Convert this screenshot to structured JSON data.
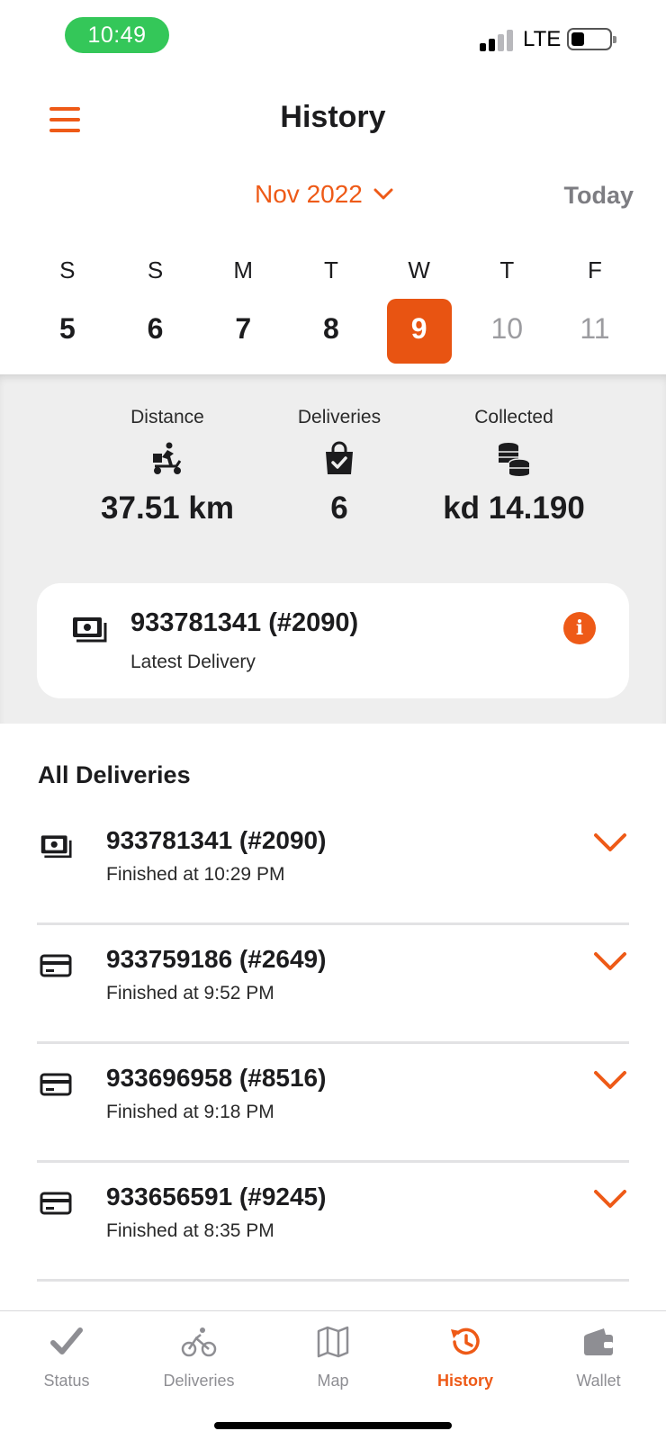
{
  "status_bar": {
    "time": "10:49",
    "network": "LTE"
  },
  "header": {
    "title": "History"
  },
  "month_picker": {
    "label": "Nov 2022",
    "today_label": "Today"
  },
  "week": [
    {
      "dow": "S",
      "day": "5",
      "state": "past"
    },
    {
      "dow": "S",
      "day": "6",
      "state": "past"
    },
    {
      "dow": "M",
      "day": "7",
      "state": "past"
    },
    {
      "dow": "T",
      "day": "8",
      "state": "past"
    },
    {
      "dow": "W",
      "day": "9",
      "state": "selected"
    },
    {
      "dow": "T",
      "day": "10",
      "state": "future"
    },
    {
      "dow": "F",
      "day": "11",
      "state": "future"
    }
  ],
  "stats": {
    "distance": {
      "label": "Distance",
      "value": "37.51 km",
      "icon": "scooter-delivery-icon"
    },
    "deliveries": {
      "label": "Deliveries",
      "value": "6",
      "icon": "shopping-bag-check-icon"
    },
    "collected": {
      "label": "Collected",
      "value": "kd 14.190",
      "icon": "coins-stack-icon"
    }
  },
  "latest": {
    "order": "933781341 (#2090)",
    "subtitle": "Latest Delivery",
    "icon": "cash-icon"
  },
  "all_deliveries": {
    "title": "All Deliveries",
    "items": [
      {
        "order": "933781341 (#2090)",
        "finished": "Finished at 10:29 PM",
        "payment": "cash"
      },
      {
        "order": "933759186 (#2649)",
        "finished": "Finished at 9:52 PM",
        "payment": "card"
      },
      {
        "order": "933696958 (#8516)",
        "finished": "Finished at 9:18 PM",
        "payment": "card"
      },
      {
        "order": "933656591 (#9245)",
        "finished": "Finished at 8:35 PM",
        "payment": "card"
      }
    ]
  },
  "tab_bar": {
    "items": [
      {
        "label": "Status",
        "icon": "checkmark-icon"
      },
      {
        "label": "Deliveries",
        "icon": "bicycle-icon"
      },
      {
        "label": "Map",
        "icon": "map-icon"
      },
      {
        "label": "History",
        "icon": "history-icon",
        "active": true
      },
      {
        "label": "Wallet",
        "icon": "wallet-icon"
      }
    ]
  },
  "colors": {
    "accent": "#ee5a17",
    "selected_day": "#e85412",
    "status_pill": "#34c759",
    "panel_bg": "#eeeeee",
    "inactive_tab": "#8e8e93"
  }
}
